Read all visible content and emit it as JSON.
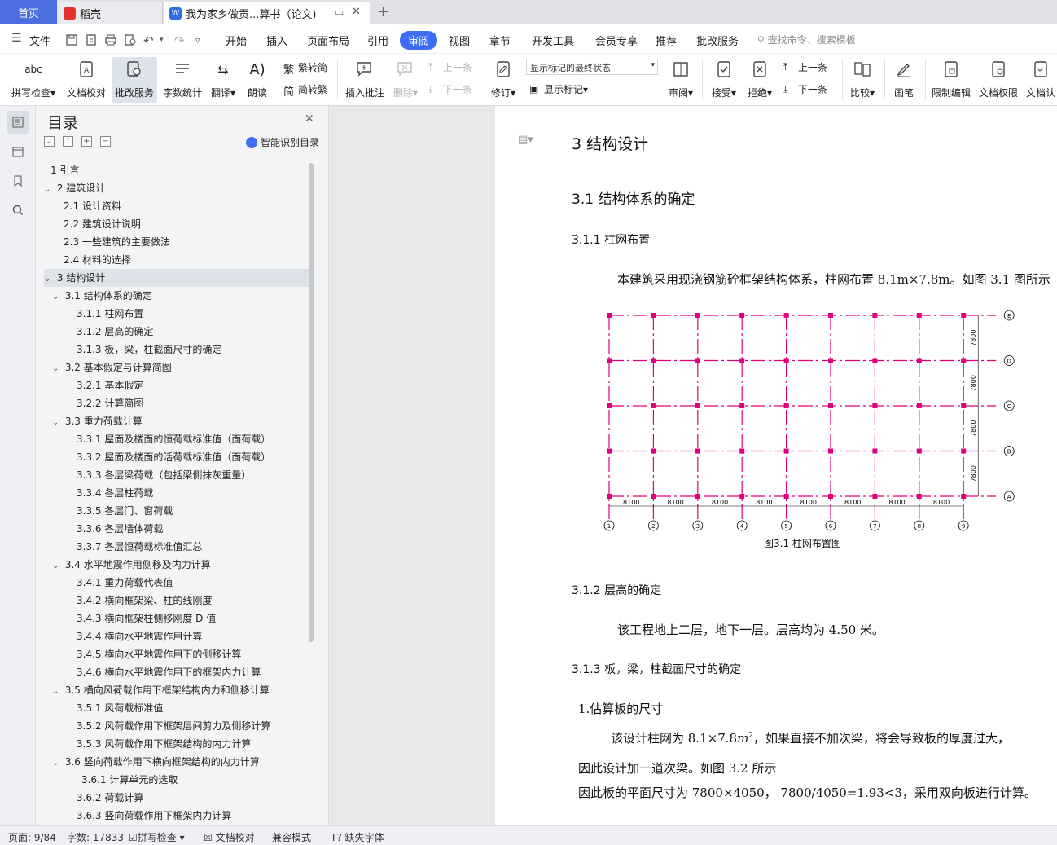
{
  "titlebar": {
    "home": "首页",
    "tab1": "稻壳",
    "tab2": "我为家乡做贡...算书（论文)",
    "new_tab": "+"
  },
  "menubar": {
    "file": "文件",
    "items": [
      "开始",
      "插入",
      "页面布局",
      "引用",
      "审阅",
      "视图",
      "章节",
      "开发工具",
      "会员专享",
      "推荐",
      "批改服务"
    ],
    "active": "审阅",
    "search": "查找命令、搜索模板"
  },
  "ribbon": {
    "spell": "拼写检查",
    "doc_check": "文档校对",
    "correct_service": "批改服务",
    "word_count": "字数统计",
    "translate": "翻译",
    "read_aloud": "朗读",
    "to_traditional": "繁转简",
    "to_simplified": "简转繁",
    "insert_comment": "插入批注",
    "delete": "删除",
    "prev": "上一条",
    "next": "下一条",
    "markup_state": "显示标记的最终状态",
    "revise": "修订",
    "show_markup": "显示标记",
    "review": "审阅",
    "accept": "接受",
    "reject": "拒绝",
    "prev2": "上一条",
    "next2": "下一条",
    "compare": "比较",
    "pen": "画笔",
    "restrict_edit": "限制编辑",
    "doc_permission": "文档权限",
    "doc_cert": "文档认"
  },
  "toc": {
    "title": "目录",
    "smart": "智能识别目录",
    "items": [
      {
        "label": "1  引言",
        "level": 1,
        "toggle": ""
      },
      {
        "label": "2  建筑设计",
        "level": 1,
        "toggle": "v"
      },
      {
        "label": "2.1  设计资料",
        "level": 2,
        "toggle": ""
      },
      {
        "label": "2.2  建筑设计说明",
        "level": 2,
        "toggle": ""
      },
      {
        "label": "2.3 一些建筑的主要做法",
        "level": 2,
        "toggle": ""
      },
      {
        "label": "2.4 材料的选择",
        "level": 2,
        "toggle": ""
      },
      {
        "label": "3 结构设计",
        "level": 1,
        "toggle": "v",
        "selected": true
      },
      {
        "label": "3.1 结构体系的确定",
        "level": 2,
        "toggle": "v"
      },
      {
        "label": "3.1.1 柱网布置",
        "level": 3,
        "toggle": ""
      },
      {
        "label": "3.1.2  层高的确定",
        "level": 3,
        "toggle": ""
      },
      {
        "label": "3.1.3  板，梁，柱截面尺寸的确定",
        "level": 3,
        "toggle": ""
      },
      {
        "label": "3.2 基本假定与计算简图",
        "level": 2,
        "toggle": "v"
      },
      {
        "label": "3.2.1 基本假定",
        "level": 3,
        "toggle": ""
      },
      {
        "label": "3.2.2 计算简图",
        "level": 3,
        "toggle": ""
      },
      {
        "label": "3.3 重力荷载计算",
        "level": 2,
        "toggle": "v"
      },
      {
        "label": "3.3.1 屋面及楼面的恒荷载标准值（面荷载）",
        "level": 3,
        "toggle": ""
      },
      {
        "label": "3.3.2 屋面及楼面的活荷载标准值（面荷载）",
        "level": 3,
        "toggle": ""
      },
      {
        "label": "3.3.3 各层梁荷载（包括梁侧抹灰重量）",
        "level": 3,
        "toggle": ""
      },
      {
        "label": "3.3.4 各层柱荷载",
        "level": 3,
        "toggle": ""
      },
      {
        "label": "3.3.5 各层门、窗荷载",
        "level": 3,
        "toggle": ""
      },
      {
        "label": "3.3.6 各层墙体荷载",
        "level": 3,
        "toggle": ""
      },
      {
        "label": "3.3.7 各层恒荷载标准值汇总",
        "level": 3,
        "toggle": ""
      },
      {
        "label": "3.4 水平地震作用侧移及内力计算",
        "level": 2,
        "toggle": "v"
      },
      {
        "label": "3.4.1 重力荷载代表值",
        "level": 3,
        "toggle": ""
      },
      {
        "label": "3.4.2 横向框架梁、柱的线刚度",
        "level": 3,
        "toggle": ""
      },
      {
        "label": "3.4.3 横向框架柱侧移刚度 D 值",
        "level": 3,
        "toggle": ""
      },
      {
        "label": "3.4.4 横向水平地震作用计算",
        "level": 3,
        "toggle": ""
      },
      {
        "label": "3.4.5 横向水平地震作用下的侧移计算",
        "level": 3,
        "toggle": ""
      },
      {
        "label": "3.4.6 横向水平地震作用下的框架内力计算",
        "level": 3,
        "toggle": ""
      },
      {
        "label": "3.5  横向风荷载作用下框架结构内力和侧移计算",
        "level": 2,
        "toggle": "v"
      },
      {
        "label": "3.5.1  风荷载标准值",
        "level": 3,
        "toggle": ""
      },
      {
        "label": "3.5.2  风荷载作用下框架层间剪力及侧移计算",
        "level": 3,
        "toggle": ""
      },
      {
        "label": "3.5.3  风荷载作用下框架结构的内力计算",
        "level": 3,
        "toggle": ""
      },
      {
        "label": "3.6  竖向荷载作用下横向框架结构的内力计算",
        "level": 2,
        "toggle": "v"
      },
      {
        "label": "3.6.1  计算单元的选取",
        "level": 4,
        "toggle": ""
      },
      {
        "label": "3.6.2 荷载计算",
        "level": 3,
        "toggle": ""
      },
      {
        "label": "3.6.3 竖向荷载作用下框架内力计算",
        "level": 3,
        "toggle": ""
      }
    ]
  },
  "doc": {
    "h1": "3 结构设计",
    "h2": "3.1 结构体系的确定",
    "h3a": "3.1.1 柱网布置",
    "p1": "本建筑采用现浇钢筋砼框架结构体系，柱网布置 8.1m×7.8m。如图 3.1 图所示",
    "fig_caption": "图3.1     柱网布置图",
    "fig_spans": [
      "8100",
      "8100",
      "8100",
      "8100",
      "8100",
      "8100",
      "8100",
      "8100"
    ],
    "fig_heights": [
      "7800",
      "7800",
      "7800",
      "7800"
    ],
    "fig_axis_cols": [
      "1",
      "2",
      "3",
      "4",
      "5",
      "6",
      "7",
      "8",
      "9"
    ],
    "fig_axis_rows": [
      "E",
      "D",
      "C",
      "B",
      "A"
    ],
    "h3b": "3.1.2  层高的确定",
    "p2": "该工程地上二层，地下一层。层高均为 4.50 米。",
    "h3c": "3.1.3  板，梁，柱截面尺寸的确定",
    "p3": "1.估算板的尺寸",
    "p4a": "该设计柱网为 8.1×7.8",
    "p4m": "m",
    "p4sup": "2",
    "p4b": "，如果直接不加次梁，将会导致板的厚度过大，",
    "p5": "因此设计加一道次梁。如图 3.2 所示",
    "p6": "因此板的平面尺寸为 7800×4050，        7800/4050=1.93<3，采用双向板进行计算。"
  },
  "status": {
    "page": "页面: 9/84",
    "words": "字数: 17833",
    "spell": "拼写检查",
    "doc_check": "文档校对",
    "compat": "兼容模式",
    "missing_font": "缺失字体"
  },
  "colors": {
    "accent": "#3d6df2",
    "grid": "#e0007a",
    "home_tab": "#4b6fe0"
  }
}
